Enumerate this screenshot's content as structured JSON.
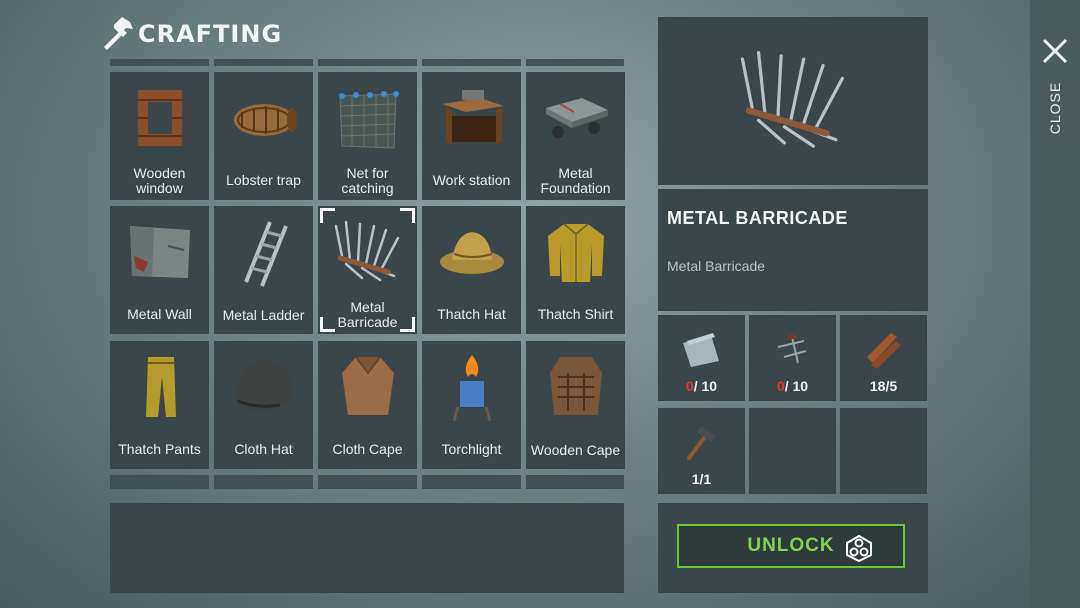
{
  "header": {
    "title": "CRAFTING",
    "icon": "hammer-icon"
  },
  "grid": {
    "items": [
      {
        "label": "Wooden window",
        "icon": "wooden-window-icon"
      },
      {
        "label": "Lobster trap",
        "icon": "lobster-trap-icon"
      },
      {
        "label": "Net for catching",
        "icon": "fishing-net-icon"
      },
      {
        "label": "Work station",
        "icon": "work-station-icon"
      },
      {
        "label": "Metal Foundation",
        "icon": "metal-foundation-icon"
      },
      {
        "label": "Metal Wall",
        "icon": "metal-wall-icon"
      },
      {
        "label": "Metal Ladder",
        "icon": "metal-ladder-icon"
      },
      {
        "label": "Metal Barricade",
        "icon": "metal-barricade-icon",
        "selected": true
      },
      {
        "label": "Thatch Hat",
        "icon": "thatch-hat-icon"
      },
      {
        "label": "Thatch Shirt",
        "icon": "thatch-shirt-icon"
      },
      {
        "label": "Thatch Pants",
        "icon": "thatch-pants-icon"
      },
      {
        "label": "Cloth Hat",
        "icon": "cloth-hat-icon"
      },
      {
        "label": "Cloth Cape",
        "icon": "cloth-cape-icon"
      },
      {
        "label": "Torchlight",
        "icon": "torchlight-icon"
      },
      {
        "label": "Wooden Cape",
        "icon": "wooden-cape-icon"
      }
    ]
  },
  "detail": {
    "title": "METAL BARRICADE",
    "description": "Metal Barricade",
    "icon": "metal-barricade-icon"
  },
  "ingredients": [
    {
      "icon": "metal-sheet-icon",
      "have": "0",
      "need": "/ 10",
      "have_color": "#e53535"
    },
    {
      "icon": "nails-icon",
      "have": "0",
      "need": "/ 10",
      "have_color": "#e53535"
    },
    {
      "icon": "wooden-planks-icon",
      "have": "18",
      "need": "/5",
      "have_color": "#f0f2f2"
    },
    {
      "icon": "hammer-tool-icon",
      "have": "1",
      "need": "/1",
      "have_color": "#f0f2f2"
    }
  ],
  "unlock": {
    "label": "UNLOCK",
    "icon": "skill-points-icon",
    "color": "#7ed650"
  },
  "close": {
    "label": "CLOSE",
    "icon": "close-icon"
  }
}
